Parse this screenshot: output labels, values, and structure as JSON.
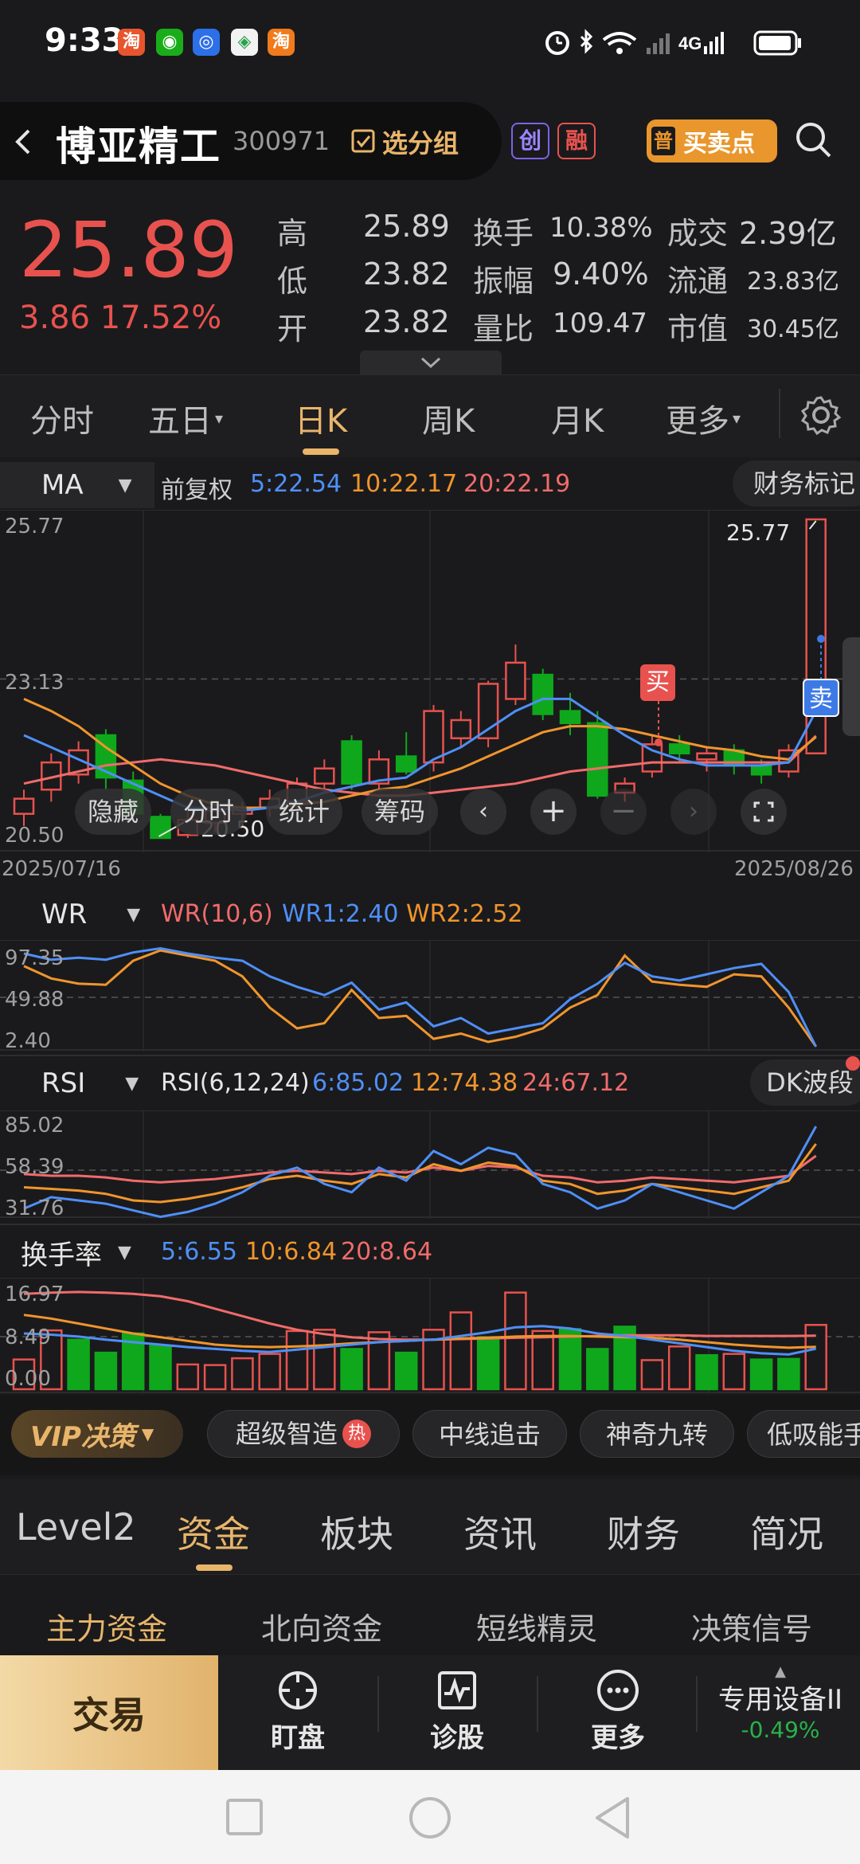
{
  "status_bar": {
    "time": "9:33",
    "network": "4G"
  },
  "header": {
    "stock_name": "博亚精工",
    "stock_code": "300971",
    "group_label": "选分组",
    "tag_chuang": "创",
    "tag_rong": "融",
    "bsp_icon": "普",
    "bsp_label": "买卖点"
  },
  "quote": {
    "price": "25.89",
    "change": "3.86 17.52%",
    "high_label": "高",
    "high": "25.89",
    "low_label": "低",
    "low": "23.82",
    "open_label": "开",
    "open": "23.82",
    "turnover_label": "换手",
    "turnover": "10.38%",
    "amplitude_label": "振幅",
    "amplitude": "9.40%",
    "vol_ratio_label": "量比",
    "vol_ratio": "109.47",
    "amount_label": "成交",
    "amount": "2.39亿",
    "float_label": "流通",
    "float": "23.83亿",
    "mcap_label": "市值",
    "mcap": "30.45亿"
  },
  "period_tabs": [
    "分时",
    "五日",
    "日K",
    "周K",
    "月K",
    "更多"
  ],
  "ma_bar": {
    "selector": "MA",
    "adjust": "前复权",
    "ma5": "5:22.54",
    "ma10": "10:22.17",
    "ma20": "20:22.19",
    "fin_marks": "财务标记"
  },
  "kline": {
    "y_top": "25.77",
    "y_mid": "23.13",
    "y_bottom": "20.50",
    "high_label": "25.77",
    "low_label": "20.50",
    "date_start": "2025/07/16",
    "date_end": "2025/08/26",
    "buy_marker": "买",
    "sell_marker": "卖",
    "tools": [
      "隐藏",
      "分时",
      "统计",
      "筹码"
    ]
  },
  "wr": {
    "selector": "WR",
    "title": "WR(10,6)",
    "wr1": "WR1:2.40",
    "wr2": "WR2:2.52",
    "y_top": "97.35",
    "y_mid": "49.88",
    "y_bottom": "2.40"
  },
  "rsi": {
    "selector": "RSI",
    "title": "RSI(6,12,24)",
    "r6": "6:85.02",
    "r12": "12:74.38",
    "r24": "24:67.12",
    "badge": "DK波段",
    "y_top": "85.02",
    "y_mid": "58.39",
    "y_bottom": "31.76"
  },
  "turnover_ind": {
    "selector": "换手率",
    "ma5": "5:6.55",
    "ma10": "10:6.84",
    "ma20": "20:8.64",
    "y_top": "16.97",
    "y_mid": "8.49",
    "y_bottom": "0.00"
  },
  "strategy_bar": {
    "vip": "VIP决策",
    "items": [
      "超级智造",
      "中线追击",
      "神奇九转",
      "低吸能手"
    ],
    "hot": "热"
  },
  "bottom_tabs": [
    "Level2",
    "资金",
    "板块",
    "资讯",
    "财务",
    "简况"
  ],
  "sub_tabs": [
    "主力资金",
    "北向资金",
    "短线精灵",
    "决策信号"
  ],
  "dock": {
    "trade": "交易",
    "watch": "盯盘",
    "diagnose": "诊股",
    "more": "更多",
    "sector_name": "专用设备II",
    "sector_change": "-0.49%"
  },
  "colors": {
    "up": "#e8524e",
    "down": "#0fa81c",
    "ma5": "#4f8ff7",
    "ma10": "#f0952d",
    "ma20": "#f16b6b",
    "accent": "#e8b56b"
  },
  "chart_data": [
    {
      "type": "candlestick",
      "title": "日K",
      "ylim": [
        20.5,
        25.77
      ],
      "x_start": "2025/07/16",
      "x_end": "2025/08/26",
      "candles": [
        {
          "o": 20.9,
          "c": 21.15,
          "h": 21.3,
          "l": 20.7
        },
        {
          "o": 21.3,
          "c": 21.75,
          "h": 21.9,
          "l": 21.1
        },
        {
          "o": 21.55,
          "c": 21.95,
          "h": 22.1,
          "l": 21.4
        },
        {
          "o": 22.2,
          "c": 21.5,
          "h": 22.3,
          "l": 21.3
        },
        {
          "o": 21.45,
          "c": 20.9,
          "h": 21.6,
          "l": 20.8
        },
        {
          "o": 20.85,
          "c": 20.5,
          "h": 20.9,
          "l": 20.5
        },
        {
          "o": 20.55,
          "c": 20.8,
          "h": 20.95,
          "l": 20.5
        },
        {
          "o": 20.75,
          "c": 20.95,
          "h": 21.1,
          "l": 20.6
        },
        {
          "o": 20.9,
          "c": 21.0,
          "h": 21.1,
          "l": 20.7
        },
        {
          "o": 21.0,
          "c": 21.15,
          "h": 21.3,
          "l": 20.85
        },
        {
          "o": 21.1,
          "c": 21.4,
          "h": 21.5,
          "l": 20.95
        },
        {
          "o": 21.4,
          "c": 21.65,
          "h": 21.8,
          "l": 21.25
        },
        {
          "o": 22.1,
          "c": 21.4,
          "h": 22.2,
          "l": 21.3
        },
        {
          "o": 21.4,
          "c": 21.8,
          "h": 21.95,
          "l": 21.3
        },
        {
          "o": 21.85,
          "c": 21.6,
          "h": 22.25,
          "l": 21.55
        },
        {
          "o": 21.75,
          "c": 22.6,
          "h": 22.7,
          "l": 21.6
        },
        {
          "o": 22.15,
          "c": 22.45,
          "h": 22.6,
          "l": 22.0
        },
        {
          "o": 22.15,
          "c": 23.05,
          "h": 23.1,
          "l": 22.0
        },
        {
          "o": 22.8,
          "c": 23.4,
          "h": 23.7,
          "l": 22.7
        },
        {
          "o": 23.2,
          "c": 22.55,
          "h": 23.3,
          "l": 22.45
        },
        {
          "o": 22.6,
          "c": 22.4,
          "h": 22.9,
          "l": 22.2
        },
        {
          "o": 22.4,
          "c": 21.2,
          "h": 22.6,
          "l": 21.15
        },
        {
          "o": 21.25,
          "c": 21.4,
          "h": 21.5,
          "l": 21.1
        },
        {
          "o": 21.6,
          "c": 22.05,
          "h": 22.2,
          "l": 21.5
        },
        {
          "o": 22.05,
          "c": 21.9,
          "h": 22.2,
          "l": 21.75
        },
        {
          "o": 21.8,
          "c": 21.9,
          "h": 22.0,
          "l": 21.6
        },
        {
          "o": 21.95,
          "c": 21.7,
          "h": 22.05,
          "l": 21.55
        },
        {
          "o": 21.7,
          "c": 21.55,
          "h": 21.8,
          "l": 21.4
        },
        {
          "o": 21.6,
          "c": 21.95,
          "h": 22.05,
          "l": 21.5
        },
        {
          "o": 21.9,
          "c": 25.77,
          "h": 25.77,
          "l": 21.9
        }
      ],
      "ma5": [
        22.2,
        22.0,
        21.8,
        21.6,
        21.4,
        21.2,
        21.0,
        21.0,
        20.95,
        21.0,
        21.1,
        21.25,
        21.35,
        21.45,
        21.5,
        21.8,
        22.0,
        22.3,
        22.6,
        22.8,
        22.8,
        22.5,
        22.2,
        21.95,
        21.8,
        21.7,
        21.7,
        21.7,
        21.75,
        22.6
      ],
      "ma10": [
        22.8,
        22.6,
        22.35,
        22.0,
        21.7,
        21.4,
        21.2,
        21.05,
        21.0,
        21.0,
        21.05,
        21.1,
        21.2,
        21.3,
        21.35,
        21.5,
        21.65,
        21.85,
        22.05,
        22.25,
        22.35,
        22.35,
        22.3,
        22.2,
        22.1,
        22.0,
        21.95,
        21.85,
        21.8,
        22.17
      ],
      "ma20": [
        21.4,
        21.5,
        21.6,
        21.7,
        21.75,
        21.8,
        21.75,
        21.7,
        21.6,
        21.5,
        21.4,
        21.3,
        21.25,
        21.2,
        21.2,
        21.25,
        21.3,
        21.35,
        21.4,
        21.5,
        21.6,
        21.65,
        21.7,
        21.75,
        21.75,
        21.75,
        21.75,
        21.75,
        21.75,
        22.19
      ]
    },
    {
      "type": "line",
      "title": "WR(10,6)",
      "ylim": [
        2.4,
        97.35
      ],
      "series": [
        {
          "name": "WR1",
          "values": [
            92,
            86,
            88,
            86,
            93,
            97,
            92,
            88,
            85,
            70,
            60,
            52,
            64,
            38,
            45,
            22,
            30,
            15,
            20,
            25,
            48,
            63,
            83,
            70,
            66,
            72,
            78,
            82,
            55,
            2.4
          ]
        },
        {
          "name": "WR2",
          "values": [
            80,
            68,
            63,
            62,
            85,
            95,
            90,
            85,
            70,
            40,
            20,
            25,
            57,
            30,
            32,
            10,
            15,
            7,
            12,
            20,
            40,
            52,
            90,
            65,
            62,
            60,
            72,
            70,
            40,
            2.52
          ]
        }
      ]
    },
    {
      "type": "line",
      "title": "RSI(6,12,24)",
      "ylim": [
        31.76,
        85.02
      ],
      "series": [
        {
          "name": "RSI6",
          "values": [
            35,
            42,
            40,
            38,
            34,
            30,
            33,
            38,
            45,
            55,
            60,
            50,
            45,
            60,
            52,
            70,
            62,
            72,
            68,
            50,
            45,
            35,
            40,
            50,
            45,
            40,
            35,
            45,
            55,
            85.02
          ]
        },
        {
          "name": "RSI12",
          "values": [
            48,
            47,
            46,
            44,
            40,
            39,
            41,
            44,
            48,
            53,
            55,
            52,
            50,
            56,
            54,
            62,
            58,
            63,
            61,
            52,
            50,
            44,
            46,
            50,
            48,
            46,
            44,
            48,
            52,
            74.38
          ]
        },
        {
          "name": "RSI24",
          "values": [
            56,
            55,
            55,
            54,
            52,
            51,
            52,
            53,
            55,
            57,
            58,
            57,
            56,
            58,
            57,
            60,
            58,
            61,
            60,
            55,
            54,
            51,
            52,
            54,
            53,
            52,
            51,
            53,
            55,
            67.12
          ]
        }
      ]
    },
    {
      "type": "bar",
      "title": "换手率",
      "ylim": [
        0,
        16.97
      ],
      "values": [
        4.8,
        9.5,
        8.0,
        5.9,
        9.0,
        7.0,
        4.0,
        3.9,
        5.0,
        5.7,
        9.4,
        9.6,
        6.5,
        9.2,
        5.9,
        9.6,
        12.4,
        8.4,
        15.6,
        9.4,
        9.7,
        6.5,
        10.1,
        4.7,
        6.9,
        5.5,
        5.7,
        4.8,
        4.9,
        10.38
      ],
      "up": [
        true,
        true,
        false,
        false,
        false,
        false,
        true,
        true,
        true,
        true,
        true,
        true,
        false,
        true,
        false,
        true,
        true,
        false,
        true,
        true,
        false,
        false,
        false,
        true,
        true,
        false,
        true,
        false,
        false,
        true
      ],
      "series": [
        {
          "name": "5",
          "values": [
            9.0,
            8.8,
            8.5,
            8.0,
            7.6,
            7.2,
            6.8,
            6.5,
            6.2,
            6.0,
            6.4,
            6.8,
            7.2,
            7.6,
            7.8,
            8.0,
            8.6,
            9.2,
            10.0,
            10.2,
            9.8,
            9.0,
            8.6,
            8.0,
            7.4,
            6.8,
            6.2,
            5.8,
            5.6,
            6.55
          ]
        },
        {
          "name": "10",
          "values": [
            12.0,
            11.4,
            10.6,
            9.8,
            9.0,
            8.4,
            7.8,
            7.2,
            6.9,
            6.8,
            6.9,
            7.1,
            7.4,
            7.6,
            7.8,
            8.0,
            8.2,
            8.3,
            8.5,
            8.6,
            8.6,
            8.5,
            8.4,
            8.3,
            8.0,
            7.6,
            7.2,
            6.9,
            6.7,
            6.84
          ]
        },
        {
          "name": "20",
          "values": [
            15.4,
            15.6,
            15.7,
            15.6,
            15.4,
            15.0,
            14.2,
            13.0,
            11.8,
            10.6,
            9.6,
            8.9,
            8.4,
            8.1,
            8.0,
            8.0,
            8.1,
            8.2,
            8.3,
            8.4,
            8.5,
            8.6,
            8.7,
            8.7,
            8.7,
            8.6,
            8.6,
            8.6,
            8.6,
            8.64
          ]
        }
      ]
    }
  ]
}
